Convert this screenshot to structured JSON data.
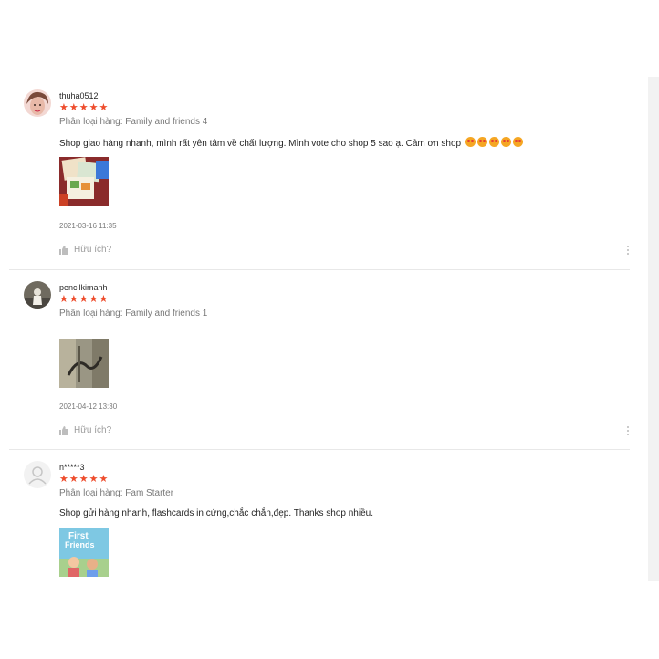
{
  "reviews": [
    {
      "username": "thuha0512",
      "stars": "★★★★★",
      "variation": "Phân loại hàng: Family and friends 4",
      "comment": "Shop giao hàng nhanh, mình rất yên tâm về chất lượng. Mình vote cho shop 5 sao ạ. Cảm ơn shop",
      "emoji_count": 5,
      "date": "2021-03-16 11:35",
      "helpful": "Hữu ích?"
    },
    {
      "username": "pencilkimanh",
      "stars": "★★★★★",
      "variation": "Phân loại hàng: Family and friends 1",
      "comment": "",
      "date": "2021-04-12 13:30",
      "helpful": "Hữu ích?"
    },
    {
      "username": "n*****3",
      "stars": "★★★★★",
      "variation": "Phân loại hàng: Fam Starter",
      "comment": "Shop gửi hàng nhanh, flashcards in cứng,chắc chắn,đẹp. Thanks shop nhiều.",
      "thumb_text": [
        "First",
        "Friends"
      ]
    }
  ],
  "colors": {
    "star": "#ee4d2d",
    "secondary_text": "#757575"
  },
  "icons": {
    "like": "thumbs-up-icon",
    "more": "more-vertical-icon"
  }
}
